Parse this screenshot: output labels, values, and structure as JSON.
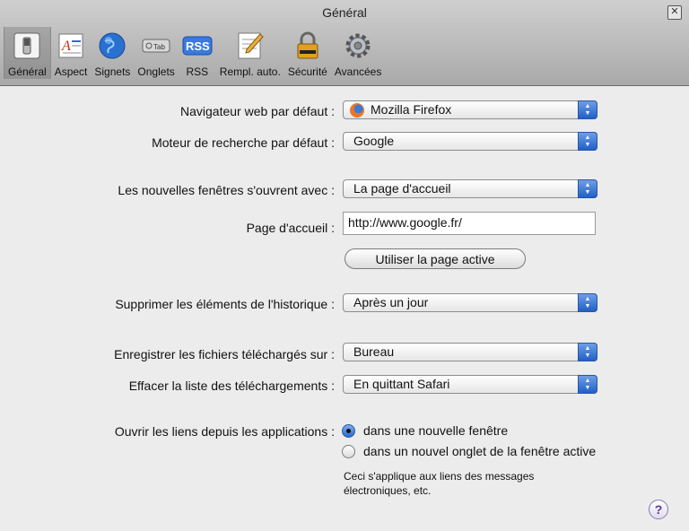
{
  "window": {
    "title": "Général",
    "close": "✕"
  },
  "toolbar": {
    "items": [
      {
        "label": "Général",
        "icon": "switch-icon"
      },
      {
        "label": "Aspect",
        "icon": "font-icon"
      },
      {
        "label": "Signets",
        "icon": "globe-icon"
      },
      {
        "label": "Onglets",
        "icon": "tab-icon",
        "badge": "Tab"
      },
      {
        "label": "RSS",
        "icon": "rss-icon",
        "badge": "RSS"
      },
      {
        "label": "Rempl. auto.",
        "icon": "autofill-pencil-icon"
      },
      {
        "label": "Sécurité",
        "icon": "lock-icon"
      },
      {
        "label": "Avancées",
        "icon": "gear-icon"
      }
    ]
  },
  "settings": {
    "default_browser": {
      "label": "Navigateur web par défaut :",
      "value": "Mozilla Firefox"
    },
    "default_search": {
      "label": "Moteur de recherche par défaut :",
      "value": "Google"
    },
    "new_windows": {
      "label": "Les nouvelles fenêtres s'ouvrent avec :",
      "value": "La page d'accueil"
    },
    "homepage": {
      "label": "Page d'accueil :",
      "value": "http://www.google.fr/",
      "button": "Utiliser la page active"
    },
    "history": {
      "label": "Supprimer les éléments de l'historique :",
      "value": "Après un jour"
    },
    "downloads_location": {
      "label": "Enregistrer les fichiers téléchargés sur :",
      "value": "Bureau"
    },
    "clear_downloads": {
      "label": "Effacer la liste des téléchargements :",
      "value": "En quittant Safari"
    },
    "open_links": {
      "label": "Ouvrir les liens depuis les applications :",
      "option1": "dans une nouvelle fenêtre",
      "option2": "dans un nouvel onglet de la fenêtre active",
      "selected": 1,
      "note_line1": "Ceci s'applique aux liens des messages",
      "note_line2": "électroniques, etc."
    }
  },
  "help": {
    "label": "?"
  }
}
